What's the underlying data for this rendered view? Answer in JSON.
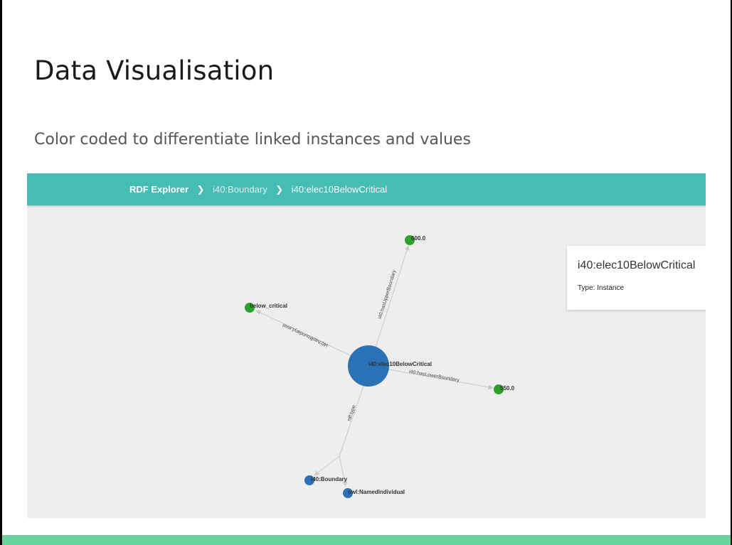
{
  "slide": {
    "title": "Data Visualisation",
    "subtitle": "Color coded to differentiate linked instances and values"
  },
  "breadcrumb": {
    "root": "RDF Explorer",
    "middle": "i40:Boundary",
    "current": "i40:elec10BelowCritical",
    "separator_icon": "chevron-right-icon"
  },
  "info_card": {
    "title": "i40:elec10BelowCritical",
    "type_text": "Type: Instance"
  },
  "graph": {
    "colors": {
      "instance": "#2a72b5",
      "value": "#2ea02e",
      "edge": "#c8c8c8",
      "header": "#45bdb5",
      "footer": "#69d49b"
    },
    "nodes": {
      "center": "i40:elec10BelowCritical",
      "upper": "600.0",
      "level": "below_critical",
      "lower": "550.0",
      "boundary": "i40:Boundary",
      "named": "owl:NamedIndividual"
    },
    "edges": {
      "upper": "i40:hasUpperBoundary",
      "level": "i40:hasBoundaryLevel",
      "lower": "i40:hasLowerBoundary",
      "type": "rdf:type"
    }
  }
}
